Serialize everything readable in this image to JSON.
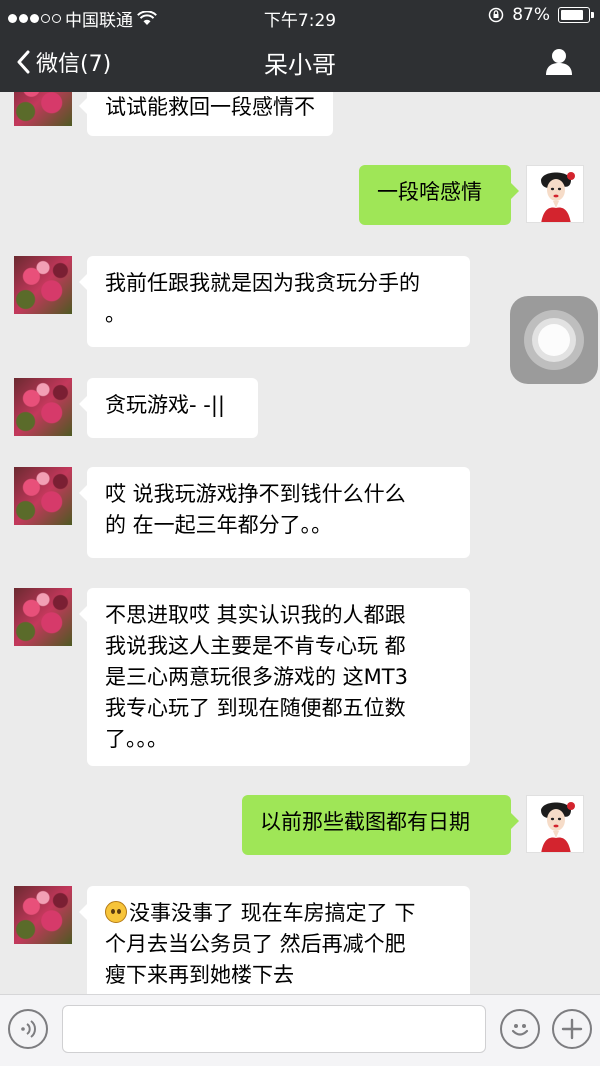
{
  "status_bar": {
    "carrier": "中国联通",
    "time": "下午7:29",
    "battery": "87%",
    "battery_level": 0.87
  },
  "navbar": {
    "back_label": "微信(7)",
    "title": "呆小哥"
  },
  "messages": [
    {
      "side": "left",
      "text": "试试能救回一段感情不"
    },
    {
      "side": "right",
      "text": "一段啥感情"
    },
    {
      "side": "left",
      "lines": [
        "我前任跟我就是因为我贪玩分手的",
        "。"
      ]
    },
    {
      "side": "left",
      "text": "贪玩游戏- -||"
    },
    {
      "side": "left",
      "lines": [
        "哎 说我玩游戏挣不到钱什么什么",
        "的 在一起三年都分了。。"
      ]
    },
    {
      "side": "left",
      "lines": [
        "不思进取哎 其实认识我的人都跟",
        "我说我这人主要是不肯专心玩  都",
        "是三心两意玩很多游戏的 这MT3",
        "我专心玩了 到现在随便都五位数",
        "了。。。"
      ]
    },
    {
      "side": "right",
      "text": "以前那些截图都有日期"
    },
    {
      "side": "left",
      "lines": [
        "没事没事了 现在车房搞定了 下",
        "个月去当公务员了 然后再减个肥",
        "瘦下来再到她楼下去"
      ],
      "emoji": "sweat-face-icon"
    }
  ],
  "input_bar": {
    "value": ""
  },
  "colors": {
    "header_bg": "#2e3033",
    "chat_bg": "#ebebeb",
    "bubble_sent": "#9fe657",
    "bubble_received": "#ffffff"
  }
}
